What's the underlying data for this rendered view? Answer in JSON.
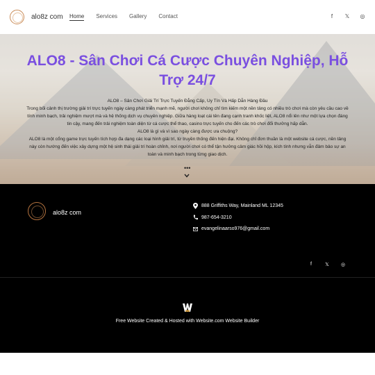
{
  "header": {
    "site_name": "alo8z com",
    "nav": [
      "Home",
      "Services",
      "Gallery",
      "Contact"
    ],
    "social": [
      {
        "icon": "facebook-icon",
        "glyph": "f"
      },
      {
        "icon": "x-icon",
        "glyph": "𝕏"
      },
      {
        "icon": "instagram-icon",
        "glyph": "◎"
      }
    ]
  },
  "hero": {
    "title": "ALO8 - Sân Chơi Cá Cược Chuyên Nghiệp, Hỗ Trợ 24/7",
    "paragraphs": [
      "ALO8 – Sân Chơi Giải Trí Trực Tuyến Đẳng Cấp, Uy Tín Và Hấp Dẫn Hàng Đầu",
      "Trong bối cảnh thị trường giải trí trực tuyến ngày càng phát triển mạnh mẽ, người chơi không chỉ tìm kiếm một nền tảng có nhiều trò chơi mà còn yêu cầu cao về tính minh bạch, trải nghiệm mượt mà và hệ thống dịch vụ chuyên nghiệp. Giữa hàng loạt cái tên đang cạnh tranh khốc liệt, ALO8 nổi lên như một lựa chọn đáng tin cậy, mang đến trải nghiệm toàn diện từ cá cược thể thao, casino trực tuyến cho đến các trò chơi đổi thưởng hấp dẫn.",
      "ALO8 là gì và vì sao ngày càng được ưa chuộng?",
      "ALO8 là một cổng game trực tuyến tích hợp đa dạng các loại hình giải trí, từ truyền thống đến hiện đại. Không chỉ đơn thuần là một website cá cược, nền tảng này còn hướng đến việc xây dựng một hệ sinh thái giải trí hoàn chỉnh, nơi người chơi có thể tận hưởng cảm giác hồi hộp, kích tính nhưng vẫn đảm bảo sự an toàn và minh bạch trong từng giao dịch."
    ],
    "more": "•••"
  },
  "footer": {
    "site_name": "alo8z com",
    "address": "888 Griffiths Way, Mainland ML 12345",
    "phone": "987-654-3210",
    "email": "evangelinaarso976@gmail.com",
    "social": [
      {
        "icon": "facebook-icon",
        "glyph": "f"
      },
      {
        "icon": "x-icon",
        "glyph": "𝕏"
      },
      {
        "icon": "instagram-icon",
        "glyph": "◎"
      }
    ],
    "builder_text": "Free Website Created & Hosted with Website.com Website Builder"
  },
  "colors": {
    "title": "#7a4fe0",
    "logo_ring": "#c98a55",
    "footer_bg": "#000000",
    "builder_mark": "#c8963e"
  }
}
